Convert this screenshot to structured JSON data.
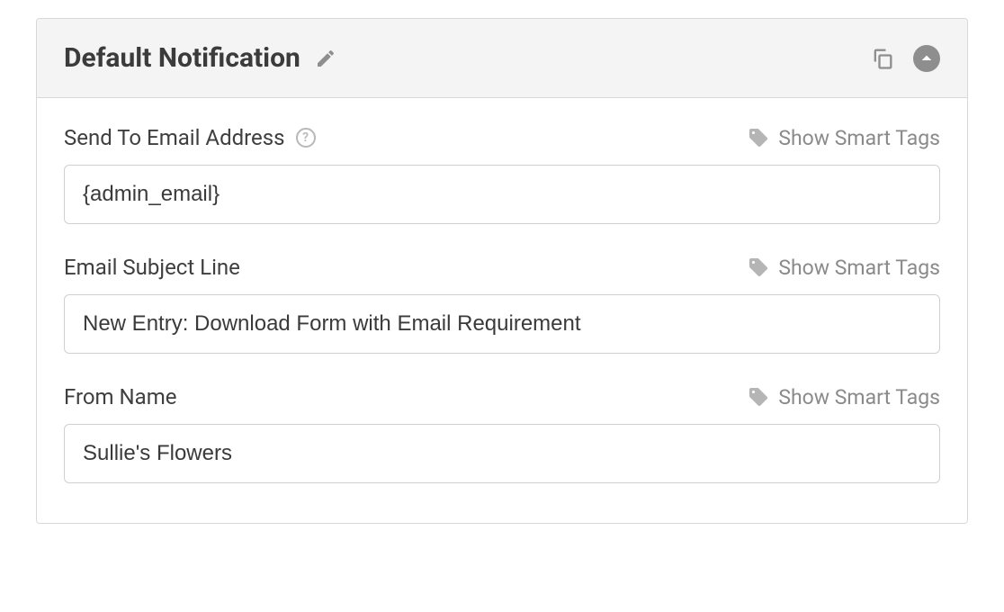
{
  "panel": {
    "title": "Default Notification"
  },
  "smart_tags_label": "Show Smart Tags",
  "help_glyph": "?",
  "fields": {
    "send_to": {
      "label": "Send To Email Address",
      "value": "{admin_email}"
    },
    "subject": {
      "label": "Email Subject Line",
      "value": "New Entry: Download Form with Email Requirement"
    },
    "from_name": {
      "label": "From Name",
      "value": "Sullie's Flowers"
    }
  }
}
